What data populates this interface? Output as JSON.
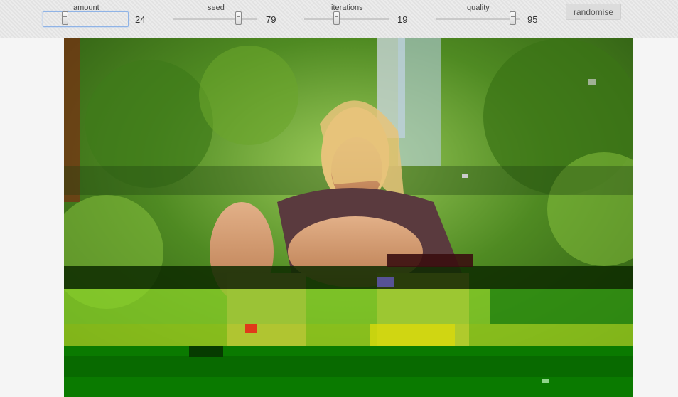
{
  "controls": {
    "amount": {
      "label": "amount",
      "value": "24",
      "level": 0.24
    },
    "seed": {
      "label": "seed",
      "value": "79",
      "level": 0.79
    },
    "iterations": {
      "label": "iterations",
      "value": "19",
      "level": 0.19
    },
    "quality": {
      "label": "quality",
      "value": "95",
      "level": 0.95
    }
  },
  "randomise_label": "randomise",
  "image": {
    "alt": "glitched photograph of a blonde woman crouching in a garden",
    "colors": {
      "foliage": "#4f8a22",
      "foliage_light": "#8cc63f",
      "glitch_green": "#0a7a00",
      "glitch_dark": "#063b00",
      "skin": "#d9a173",
      "hair": "#e6c37a",
      "top": "#5a3a3e"
    }
  }
}
